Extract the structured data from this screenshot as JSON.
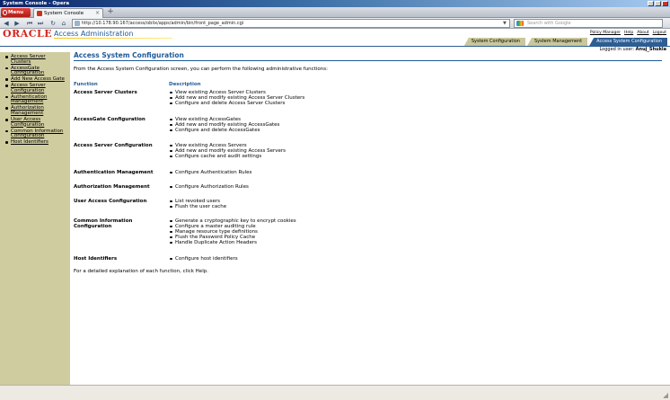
{
  "window": {
    "title": "System Console - Opera"
  },
  "browser": {
    "menu_label": "Menu",
    "tab_title": "System Console",
    "tab_close": "×",
    "new_tab": "+",
    "url": "http://10.178.90.167/access/oblix/apps/admin/bin/front_page_admin.cgi",
    "search_placeholder": "Search with Google"
  },
  "header": {
    "logo": "ORACLE",
    "app_title": "Access Administration",
    "links": [
      "Policy Manager",
      "Help",
      "About",
      "Logout"
    ],
    "tabs": [
      {
        "label": "System Configuration",
        "active": false
      },
      {
        "label": "System Management",
        "active": false
      },
      {
        "label": "Access System Configuration",
        "active": true
      }
    ],
    "logged_in_label": "Logged in user:",
    "logged_in_user": "Anuj_Shukla"
  },
  "sidebar": {
    "items": [
      {
        "label": "Access Server Clusters"
      },
      {
        "label": "AccessGate Configuration"
      },
      {
        "label": "Add New Access Gate"
      },
      {
        "label": "Access Server Configuration"
      },
      {
        "label": "Authentication Management"
      },
      {
        "label": "Authorization Management"
      },
      {
        "label": "User Access Configuration"
      },
      {
        "label": "Common Information Configuration"
      },
      {
        "label": "Host Identifiers"
      }
    ]
  },
  "main": {
    "heading": "Access System Configuration",
    "intro": "From the Access System Configuration screen, you can perform the following administrative functions:",
    "col_function": "Function",
    "col_description": "Description",
    "functions": [
      {
        "name": "Access Server Clusters",
        "desc": [
          "View existing Access Server Clusters",
          "Add new and modify existing Access Server Clusters",
          "Configure and delete Access Server Clusters"
        ]
      },
      {
        "name": "AccessGate Configuration",
        "desc": [
          "View existing AccessGates",
          "Add new and modify existing AccessGates",
          "Configure and delete AccessGates"
        ]
      },
      {
        "name": "Access Server Configuration",
        "desc": [
          "View existing Access Servers",
          "Add new and modify existing Access Servers",
          "Configure cache and audit settings"
        ]
      },
      {
        "name": "Authentication Management",
        "desc": [
          "Configure Authentication Rules"
        ]
      },
      {
        "name": "Authorization Management",
        "desc": [
          "Configure Authorization Rules"
        ]
      },
      {
        "name": "User Access Configuration",
        "desc": [
          "List revoked users",
          "Flush the user cache"
        ]
      },
      {
        "name": "Common Information Configuration",
        "desc": [
          "Generate a cryptographic key to encrypt cookies",
          "Configure a master auditing rule",
          "Manage resource type definitions",
          "Flush the Password Policy Cache",
          "Handle Duplicate Action Headers"
        ]
      },
      {
        "name": "Host Identifiers",
        "desc": [
          "Configure host identifiers"
        ]
      }
    ],
    "footnote": "For a detailed explanation of each function, click Help."
  }
}
